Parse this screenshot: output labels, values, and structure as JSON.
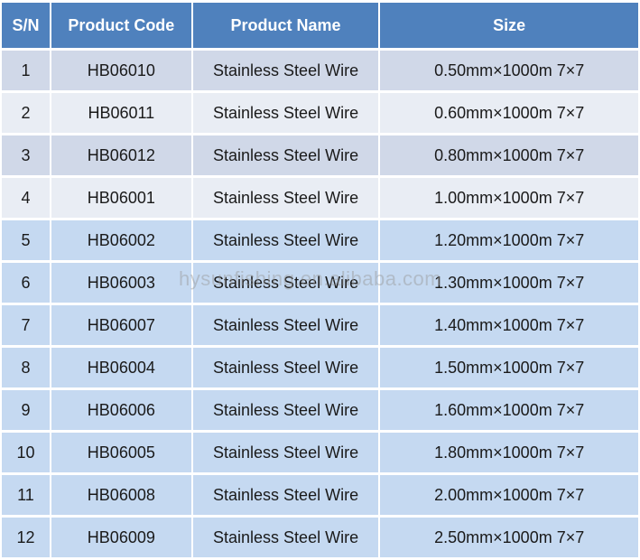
{
  "table": {
    "headers": [
      "S/N",
      "Product Code",
      "Product Name",
      "Size"
    ],
    "rows": [
      [
        "1",
        "HB06010",
        "Stainless Steel Wire",
        "0.50mm×1000m 7×7"
      ],
      [
        "2",
        "HB06011",
        "Stainless Steel Wire",
        "0.60mm×1000m 7×7"
      ],
      [
        "3",
        "HB06012",
        "Stainless Steel Wire",
        "0.80mm×1000m 7×7"
      ],
      [
        "4",
        "HB06001",
        "Stainless Steel Wire",
        "1.00mm×1000m 7×7"
      ],
      [
        "5",
        "HB06002",
        "Stainless Steel Wire",
        "1.20mm×1000m 7×7"
      ],
      [
        "6",
        "HB06003",
        "Stainless Steel Wire",
        "1.30mm×1000m 7×7"
      ],
      [
        "7",
        "HB06007",
        "Stainless Steel Wire",
        "1.40mm×1000m 7×7"
      ],
      [
        "8",
        "HB06004",
        "Stainless Steel Wire",
        "1.50mm×1000m 7×7"
      ],
      [
        "9",
        "HB06006",
        "Stainless Steel Wire",
        "1.60mm×1000m 7×7"
      ],
      [
        "10",
        "HB06005",
        "Stainless Steel Wire",
        "1.80mm×1000m 7×7"
      ],
      [
        "11",
        "HB06008",
        "Stainless Steel Wire",
        "2.00mm×1000m 7×7"
      ],
      [
        "12",
        "HB06009",
        "Stainless Steel Wire",
        "2.50mm×1000m 7×7"
      ]
    ]
  },
  "watermark": "hysunfishing.en.alibaba.com",
  "colors": {
    "header_bg": "#4f81bd",
    "row_gray_dark": "#d0d8e8",
    "row_gray_light": "#e9edf4",
    "row_blue": "#c5d9f1"
  }
}
